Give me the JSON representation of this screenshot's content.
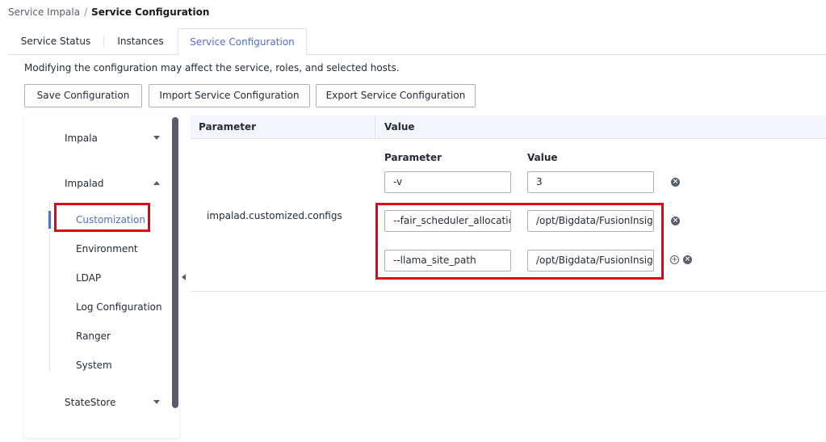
{
  "breadcrumb": {
    "parent": "Service Impala",
    "separator": "/",
    "current": "Service Configuration"
  },
  "tabs": [
    {
      "label": "Service Status"
    },
    {
      "label": "Instances"
    },
    {
      "label": "Service Configuration",
      "active": true
    }
  ],
  "notice": "Modifying the configuration may affect the service, roles, and selected hosts.",
  "toolbar": {
    "save_label": "Save Configuration",
    "import_label": "Import Service Configuration",
    "export_label": "Export Service Configuration"
  },
  "nav": {
    "groups": [
      {
        "label": "Impala",
        "expanded": false
      },
      {
        "label": "Impalad",
        "expanded": true,
        "items": [
          "Customization",
          "Environment",
          "LDAP",
          "Log Configuration",
          "Ranger",
          "System"
        ],
        "active_item": "Customization"
      },
      {
        "label": "StateStore",
        "expanded": false
      }
    ]
  },
  "table": {
    "headers": {
      "parameter": "Parameter",
      "value": "Value"
    },
    "row": {
      "name": "impalad.customized.configs",
      "sub_headers": {
        "parameter": "Parameter",
        "value": "Value"
      },
      "entries": [
        {
          "key": "-v",
          "value": "3"
        },
        {
          "key": "--fair_scheduler_allocatic",
          "value": "/opt/Bigdata/FusionInsig"
        },
        {
          "key": "--llama_site_path",
          "value": "/opt/Bigdata/FusionInsig"
        }
      ]
    }
  },
  "colors": {
    "accent": "#526ecc",
    "highlight": "#e60012",
    "header_bg": "#f3f6fc"
  },
  "icons": {
    "remove": "close-circle-icon",
    "add": "plus-circle-icon",
    "expand": "chevron-down-icon",
    "collapse": "chevron-up-icon"
  }
}
